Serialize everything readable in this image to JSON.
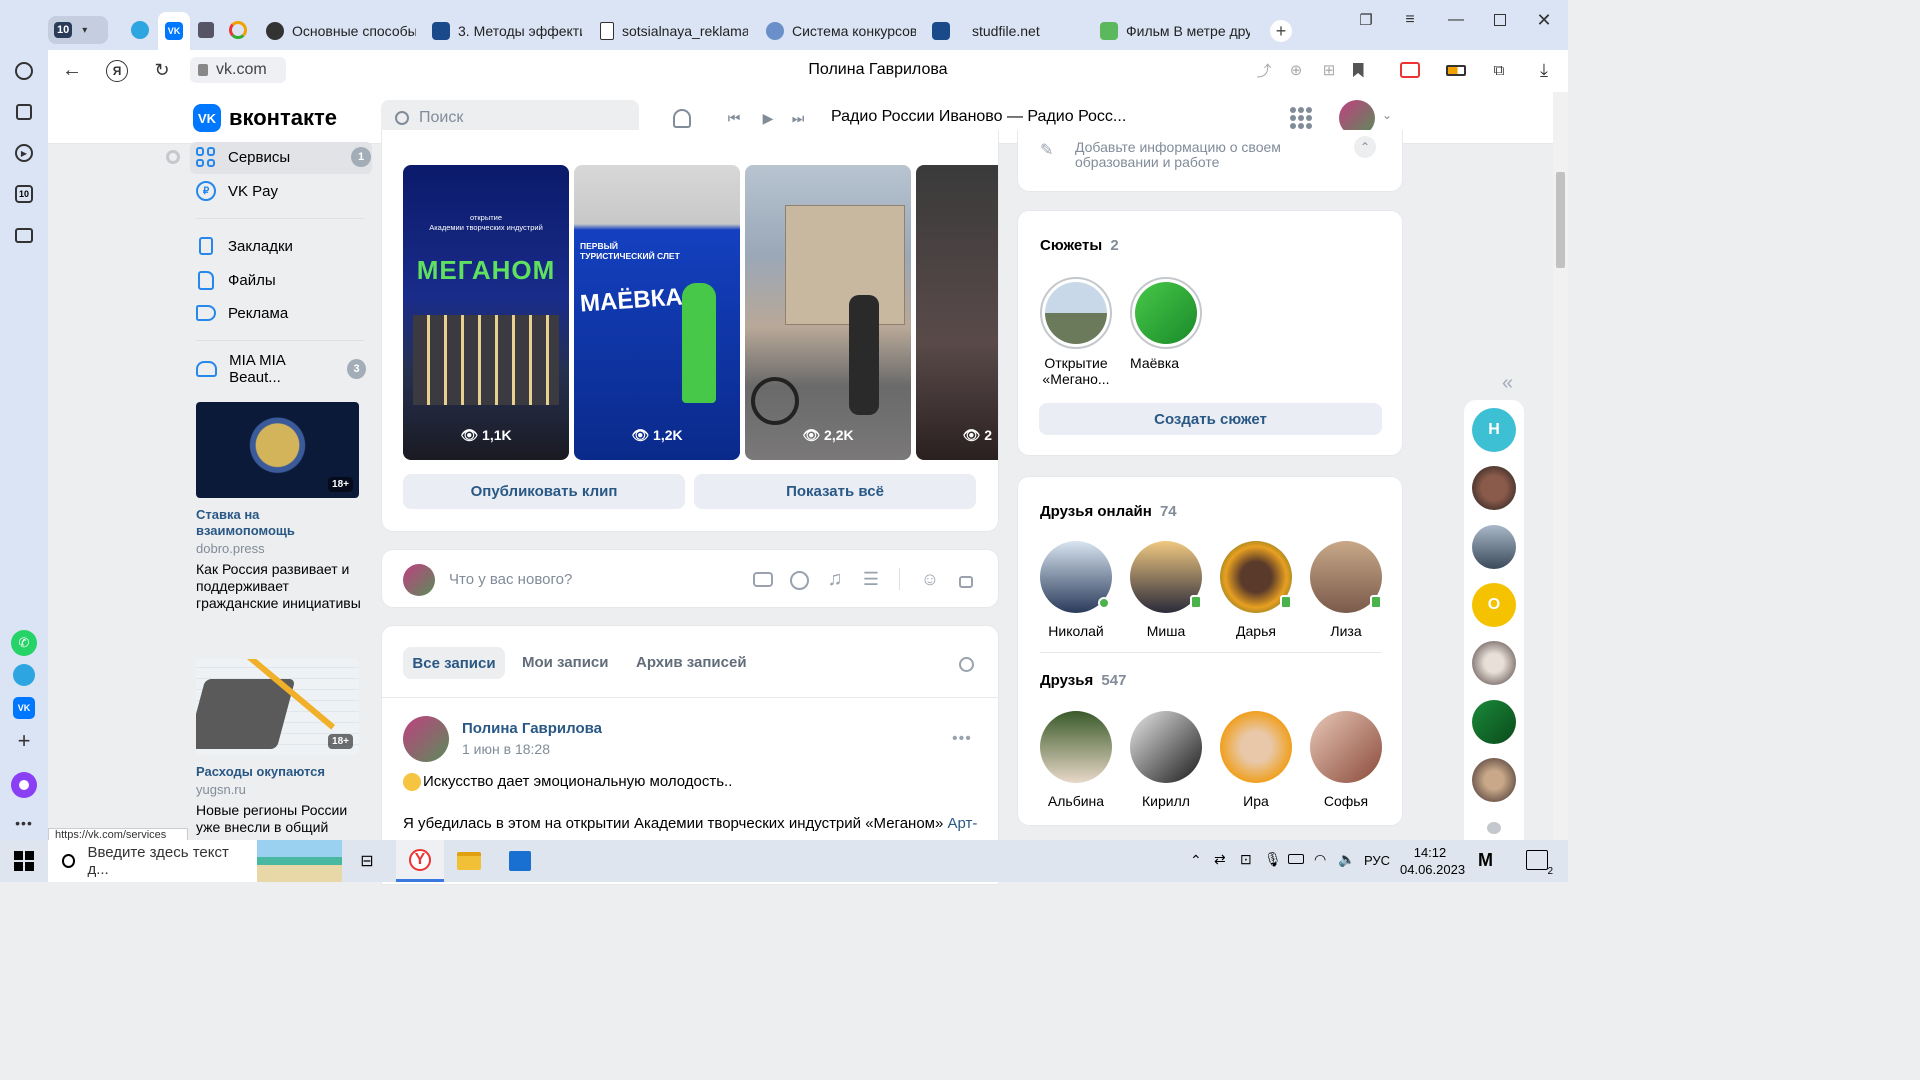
{
  "browser": {
    "tabs": [
      {
        "label": "Основные способы"
      },
      {
        "label": "3. Методы эффекти"
      },
      {
        "label": "sotsialnaya_reklama"
      },
      {
        "label": "Система конкурсов"
      },
      {
        "label": "studfile.net"
      },
      {
        "label": "Фильм В метре дру"
      }
    ],
    "tab_counter": "10",
    "address": "vk.com",
    "page_title": "Полина Гаврилова",
    "status_url": "https://vk.com/services",
    "sidebar_counter": "10"
  },
  "vk": {
    "logo_text": "вконтакте",
    "search_placeholder": "Поиск",
    "player_track": "Радио России Иваново — Радио Росс..."
  },
  "left_menu": {
    "items": [
      {
        "label": "Сервисы",
        "badge": "1"
      },
      {
        "label": "VK Pay"
      },
      {
        "label": "Закладки"
      },
      {
        "label": "Файлы"
      },
      {
        "label": "Реклама"
      },
      {
        "label": "MIA MIA Beaut...",
        "badge": "3"
      }
    ],
    "ads": [
      {
        "title": "Ставка на взаимопомощь",
        "domain": "dobro.press",
        "text": "Как Россия развивает и поддерживает гражданские инициативы",
        "age": "18+"
      },
      {
        "title": "Расходы окупаются",
        "domain": "yugsn.ru",
        "text": "Новые регионы России уже внесли в общий",
        "age": "18+"
      }
    ]
  },
  "clips": {
    "items": [
      {
        "views": "1,1K",
        "caption_top": "открытие\nАкадемии творческих индустрий",
        "caption_main": "МЕГАНОМ"
      },
      {
        "views": "1,2K",
        "caption_top": "ПЕРВЫЙ\nТУРИСТИЧЕСКИЙ СЛЕТ",
        "caption_main": "МАЁВКА"
      },
      {
        "views": "2,2K"
      },
      {
        "views": "2"
      }
    ],
    "publish_label": "Опубликовать клип",
    "show_all_label": "Показать всё"
  },
  "composer": {
    "placeholder": "Что у вас нового?"
  },
  "wall": {
    "tabs": [
      "Все записи",
      "Мои записи",
      "Архив записей"
    ],
    "post": {
      "author": "Полина Гаврилова",
      "date": "1 июн в 18:28",
      "text1": "Искусство дает эмоциональную молодость..",
      "text2": "Я убедилась в этом на открытии Академии творческих индустрий «Меганом»",
      "link": "Арт-"
    }
  },
  "right": {
    "education_text": "Добавьте информацию о своем образовании и работе",
    "stories": {
      "title": "Сюжеты",
      "count": "2",
      "items": [
        {
          "label": "Открытие «Мегано..."
        },
        {
          "label": "Маёвка"
        }
      ],
      "create_label": "Создать сюжет"
    },
    "friends_online": {
      "title": "Друзья онлайн",
      "count": "74",
      "items": [
        {
          "name": "Николай"
        },
        {
          "name": "Миша"
        },
        {
          "name": "Дарья"
        },
        {
          "name": "Лиза"
        }
      ]
    },
    "friends": {
      "title": "Друзья",
      "count": "547",
      "items": [
        {
          "name": "Альбина"
        },
        {
          "name": "Кирилл"
        },
        {
          "name": "Ира"
        },
        {
          "name": "Софья"
        }
      ]
    }
  },
  "chats": {
    "letters": [
      "Н",
      "О"
    ]
  },
  "taskbar": {
    "search_placeholder": "Введите здесь текст д...",
    "lang": "РУС",
    "time": "14:12",
    "date": "04.06.2023",
    "notif_count": "2"
  }
}
